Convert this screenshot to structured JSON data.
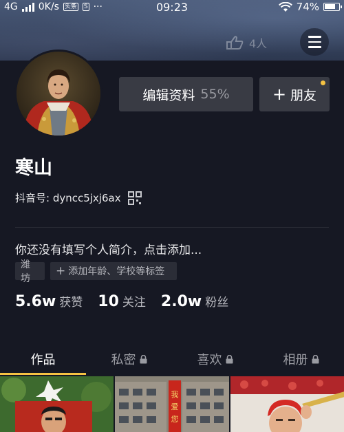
{
  "status_bar": {
    "network": "4G",
    "speed": "0K/s",
    "more": "···",
    "time": "09:23",
    "battery": "74%"
  },
  "header": {
    "visitor_count": "4人"
  },
  "profile": {
    "edit_label": "编辑资料",
    "edit_percent": "55%",
    "friend_label": "朋友",
    "friend_plus": "+",
    "username": "寒山",
    "douyin_id": "抖音号: dyncc5jxj6ax",
    "bio": "你还没有填写个人简介，点击添加...",
    "tags": {
      "location": "潍坊",
      "add_label": "添加年龄、学校等标签",
      "add_plus": "+"
    }
  },
  "stats": [
    {
      "value": "5.6w",
      "label": "获赞"
    },
    {
      "value": "10",
      "label": "关注"
    },
    {
      "value": "2.0w",
      "label": "粉丝"
    }
  ],
  "tabs": [
    {
      "label": "作品",
      "locked": false
    },
    {
      "label": "私密",
      "locked": true
    },
    {
      "label": "喜欢",
      "locked": true
    },
    {
      "label": "相册",
      "locked": true
    }
  ],
  "colors": {
    "background": "#161823",
    "button_bg": "#393b44",
    "accent": "#f5c243",
    "muted_text": "#9a9ba2"
  }
}
